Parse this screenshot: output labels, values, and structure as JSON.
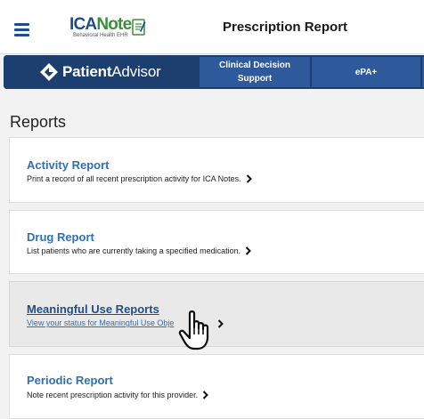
{
  "header": {
    "logo_brand_a": "ICA",
    "logo_brand_b": "Notes",
    "logo_subtitle": "Behavioral Health EHR",
    "page_title": "Prescription Report"
  },
  "navbar": {
    "brand_bold": "Patient",
    "brand_light": "Advisor",
    "tabs": [
      {
        "label_line1": "Clinical Decision",
        "label_line2": "Support"
      },
      {
        "label_line1": "ePA+"
      }
    ]
  },
  "reports": {
    "section_title": "Reports",
    "items": [
      {
        "title": "Activity Report",
        "description": "Print a record of all recent prescription activity for ICA Notes."
      },
      {
        "title": "Drug Report",
        "description": "List patients who are currently taking a specified medication."
      },
      {
        "title": "Meaningful Use Reports",
        "description": "View your status for Meaningful Use Obje",
        "state": "hover"
      },
      {
        "title": "Periodic Report",
        "description": "Note recent prescription activity for this provider."
      }
    ]
  },
  "icons": {
    "menu": "hamburger-menu-icon",
    "notepad": "notepad-icon",
    "brand": "patient-advisor-diamond-icon",
    "chevron": "chevron-right-icon",
    "cursor": "hand-pointer-cursor-icon"
  },
  "colors": {
    "navbar": "#1c3f70",
    "nav_tab": "#2e5a9c",
    "link": "#2f6fb5",
    "brand_green": "#3a8f3a"
  }
}
